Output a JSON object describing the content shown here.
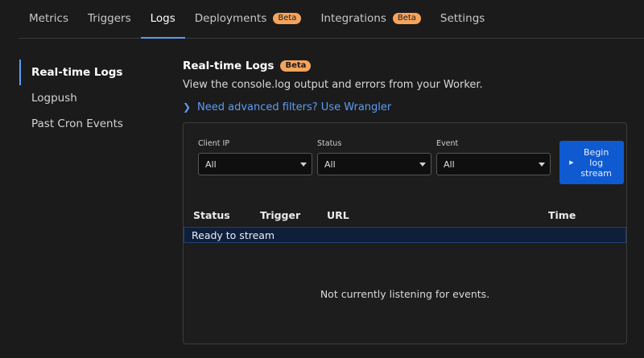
{
  "tabs": [
    {
      "label": "Metrics",
      "beta": false,
      "active": false
    },
    {
      "label": "Triggers",
      "beta": false,
      "active": false
    },
    {
      "label": "Logs",
      "beta": false,
      "active": true
    },
    {
      "label": "Deployments",
      "beta": true,
      "active": false
    },
    {
      "label": "Integrations",
      "beta": true,
      "active": false
    },
    {
      "label": "Settings",
      "beta": false,
      "active": false
    }
  ],
  "beta_label": "Beta",
  "sidebar": {
    "items": [
      {
        "label": "Real-time Logs",
        "active": true
      },
      {
        "label": "Logpush",
        "active": false
      },
      {
        "label": "Past Cron Events",
        "active": false
      }
    ]
  },
  "main": {
    "title": "Real-time Logs",
    "title_badge": "Beta",
    "description": "View the console.log output and errors from your Worker.",
    "advanced_link": "Need advanced filters? Use Wrangler"
  },
  "filters": [
    {
      "label": "Client IP",
      "value": "All"
    },
    {
      "label": "Status",
      "value": "All"
    },
    {
      "label": "Event",
      "value": "All"
    }
  ],
  "begin_button": "Begin log stream",
  "table": {
    "columns": [
      "Status",
      "Trigger",
      "URL",
      "Time"
    ],
    "ready_text": "Ready to stream",
    "empty_text": "Not currently listening for events."
  },
  "colors": {
    "accent": "#5c9df5",
    "beta_badge": "#f6a35c",
    "primary_button": "#0f5ad1",
    "background": "#1b1b1b"
  }
}
